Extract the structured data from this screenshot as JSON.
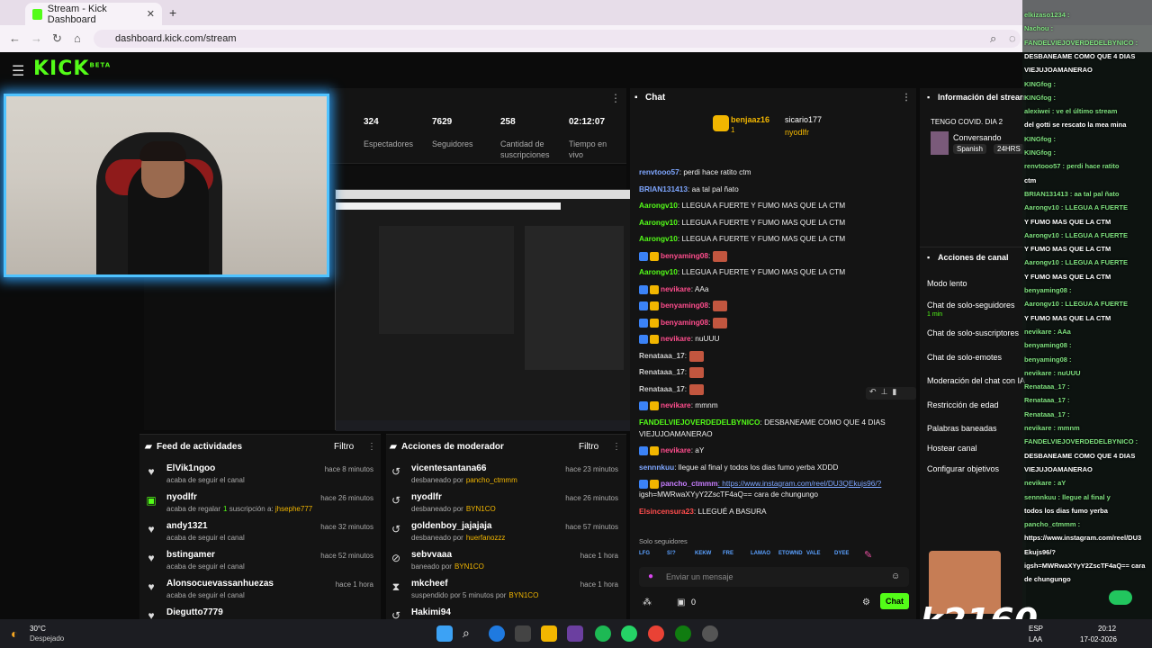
{
  "browser": {
    "tab_title": "Stream - Kick Dashboard",
    "url": "dashboard.kick.com/stream"
  },
  "header": {
    "logo": "KICK",
    "logo_badge": "BETA"
  },
  "stats": [
    {
      "value": "324",
      "label": "Espectadores"
    },
    {
      "value": "7629",
      "label": "Seguidores"
    },
    {
      "value": "258",
      "label": "Cantidad de suscripciones"
    },
    {
      "value": "02:12:07",
      "label": "Tiempo en vivo"
    }
  ],
  "preview": {
    "watermark": "k2160"
  },
  "activity": {
    "title": "Feed de actividades",
    "filter": "Filtro",
    "items": [
      {
        "name": "ElVik1ngoo",
        "desc": "acaba de seguir el canal",
        "time": "hace 8 minutos",
        "icon": "heart-icon"
      },
      {
        "name": "nyodlfr",
        "desc": "acaba de regalar",
        "desc_bold": "1",
        "desc2": " suscripción a: ",
        "desc_user": "jhsephe777",
        "time": "hace 26 minutos",
        "icon": "gift-icon"
      },
      {
        "name": "andy1321",
        "desc": "acaba de seguir el canal",
        "time": "hace 32 minutos",
        "icon": "heart-icon"
      },
      {
        "name": "bstingamer",
        "desc": "acaba de seguir el canal",
        "time": "hace 52 minutos",
        "icon": "heart-icon"
      },
      {
        "name": "Alonsocuevassanhuezas",
        "desc": "acaba de seguir el canal",
        "time": "hace 1 hora",
        "icon": "heart-icon"
      },
      {
        "name": "Diegutto7779",
        "desc": "",
        "time": "",
        "icon": "heart-icon"
      }
    ]
  },
  "modactions": {
    "title": "Acciones de moderador",
    "filter": "Filtro",
    "items": [
      {
        "name": "vicentesantana66",
        "desc": "desbaneado por",
        "by": "pancho_ctmmm",
        "time": "hace 23 minutos",
        "icon": "undo-icon"
      },
      {
        "name": "nyodlfr",
        "desc": "desbaneado por",
        "by": "BYN1CO",
        "time": "hace 26 minutos",
        "icon": "undo-icon"
      },
      {
        "name": "goldenboy_jajajaja",
        "desc": "desbaneado por",
        "by": "huerfanozzz",
        "time": "hace 57 minutos",
        "icon": "undo-icon"
      },
      {
        "name": "sebvvaaa",
        "desc": "baneado por",
        "by": "BYN1CO",
        "time": "hace 1 hora",
        "icon": "ban-icon"
      },
      {
        "name": "mkcheef",
        "desc": "suspendido por 5 minutos por",
        "by": "BYN1CO",
        "time": "hace 1 hora",
        "icon": "hourglass-icon"
      },
      {
        "name": "Hakimi94",
        "desc": "",
        "by": "",
        "time": "",
        "icon": "undo-icon"
      }
    ]
  },
  "chat": {
    "title": "Chat",
    "top_gifters": [
      "benjaaz16",
      "sicario177",
      "nyodlfr"
    ],
    "top_gifter_counts": [
      "1",
      "1"
    ],
    "messages": [
      {
        "user": "renvtooo57",
        "color": "#7ea6ff",
        "text": ": perdi hace ratito ctm"
      },
      {
        "user": "BRIAN131413",
        "color": "#7ea6ff",
        "text": ": aa tal pal ñato"
      },
      {
        "user": "Aarongv10",
        "color": "#53fc18",
        "text": ": LLEGUA A FUERTE Y FUMO MAS QUE LA CTM"
      },
      {
        "user": "Aarongv10",
        "color": "#53fc18",
        "text": ": LLEGUA A FUERTE Y FUMO MAS QUE LA CTM"
      },
      {
        "user": "Aarongv10",
        "color": "#53fc18",
        "text": ": LLEGUA A FUERTE Y FUMO MAS QUE LA CTM"
      },
      {
        "user": "benyaming08",
        "color": "#ff4d8d",
        "text": ":"
      },
      {
        "user": "Aarongv10",
        "color": "#53fc18",
        "text": ": LLEGUA A FUERTE Y FUMO MAS QUE LA CTM"
      },
      {
        "user": "nevikare",
        "color": "#ff4d8d",
        "text": ": AAa"
      },
      {
        "user": "benyaming08",
        "color": "#ff4d8d",
        "text": ":"
      },
      {
        "user": "benyaming08",
        "color": "#ff4d8d",
        "text": ":"
      },
      {
        "user": "nevikare",
        "color": "#ff4d8d",
        "text": ": nuUUU"
      },
      {
        "user": "Renataaa_17",
        "color": "#cccccc",
        "text": ":"
      },
      {
        "user": "Renataaa_17",
        "color": "#cccccc",
        "text": ":"
      },
      {
        "user": "Renataaa_17",
        "color": "#cccccc",
        "text": ":"
      },
      {
        "user": "nevikare",
        "color": "#ff4d8d",
        "text": ": mmnm"
      },
      {
        "user": "FANDELVIEJOVERDEDELBYNICO",
        "color": "#53fc18",
        "text": ": DESBANEAME COMO QUE 4 DIAS"
      },
      {
        "user": "",
        "color": "#ffffff",
        "text": "VIEJUJOAMANERAO"
      },
      {
        "user": "nevikare",
        "color": "#ff4d8d",
        "text": ": aY"
      },
      {
        "user": "sennnkuu",
        "color": "#7ea6ff",
        "text": ": llegue al final y todos los dias fumo yerba XDDD"
      },
      {
        "user": "pancho_ctmmm",
        "color": "#c77dff",
        "text": ": https://www.instagram.com/reel/DU3QEkujs96/?"
      },
      {
        "user": "",
        "color": "#ffffff",
        "text": "igsh=MWRwaXYyY2ZscTF4aQ== cara de chungungo"
      },
      {
        "user": "Elsincensura23",
        "color": "#ff4d4d",
        "text": ": LLEGUÉ A BASURA"
      }
    ],
    "followers_only": "Solo seguidores",
    "emotes": [
      "LFG",
      "S!?",
      "KEKW",
      "FRE",
      "LAMAO",
      "ETOWND",
      "VALE",
      "DYEE"
    ],
    "input_placeholder": "Enviar un mensaje",
    "points": "0",
    "send_label": "Chat"
  },
  "streaminfo": {
    "title": "Información del stream",
    "stream_title": "TENGO COVID. DIA 2",
    "category": "Conversando",
    "tags": [
      "Spanish",
      "24HRS"
    ]
  },
  "channelactions": {
    "title": "Acciones de canal",
    "items": [
      "Modo lento",
      "Chat de solo-seguidores",
      "Chat de solo-suscriptores",
      "Chat de solo-emotes",
      "Moderación del chat con IA",
      "Restricción de edad",
      "Palabras baneadas",
      "Hostear canal",
      "Configurar objetivos"
    ],
    "followers_sub": "1 min"
  },
  "overlay": {
    "lines": [
      "elkizaso1234 :",
      "Nachou :",
      "FANDELVIEJOVERDEDELBYNICO :",
      "DESBANEAME COMO QUE 4 DIAS",
      "VIEJUJOAMANERAO",
      "KINGfog :",
      "KINGfog :",
      "alexiwei : ve el último stream",
      "del gotti se rescato la mea mina",
      "KINGfog :",
      "KINGfog :",
      "renvtooo57 : perdi hace ratito",
      "ctm",
      "BRIAN131413 : aa tal pal ñato",
      "Aarongv10 : LLEGUA A FUERTE",
      "Y FUMO MAS QUE LA CTM",
      "Aarongv10 : LLEGUA A FUERTE",
      "Y FUMO MAS QUE LA CTM",
      "Aarongv10 : LLEGUA A FUERTE",
      "Y FUMO MAS QUE LA CTM",
      "benyaming08 :",
      "Aarongv10 : LLEGUA A FUERTE",
      "Y FUMO MAS QUE LA CTM",
      "nevikare : AAa",
      "benyaming08 :",
      "benyaming08 :",
      "nevikare : nuUUU",
      "Renataaa_17 :",
      "Renataaa_17 :",
      "Renataaa_17 :",
      "nevikare : mmnm",
      "FANDELVIEJOVERDEDELBYNICO :",
      "DESBANEAME COMO QUE 4 DIAS",
      "VIEJUJOAMANERAO",
      "nevikare : aY",
      "sennnkuu : llegue al final y",
      "todos los dias fumo yerba",
      "pancho_ctmmm :",
      "https://www.instagram.com/reel/DU3",
      "Ekujs96/?",
      "igsh=MWRwaXYyY2ZscTF4aQ== cara",
      "de chungungo"
    ],
    "watermark": "k2160"
  },
  "taskbar": {
    "temp": "30°C",
    "weather": "Despejado",
    "lang": "ESP",
    "lang2": "LAA",
    "time": "20:12",
    "date": "17-02-2026"
  }
}
